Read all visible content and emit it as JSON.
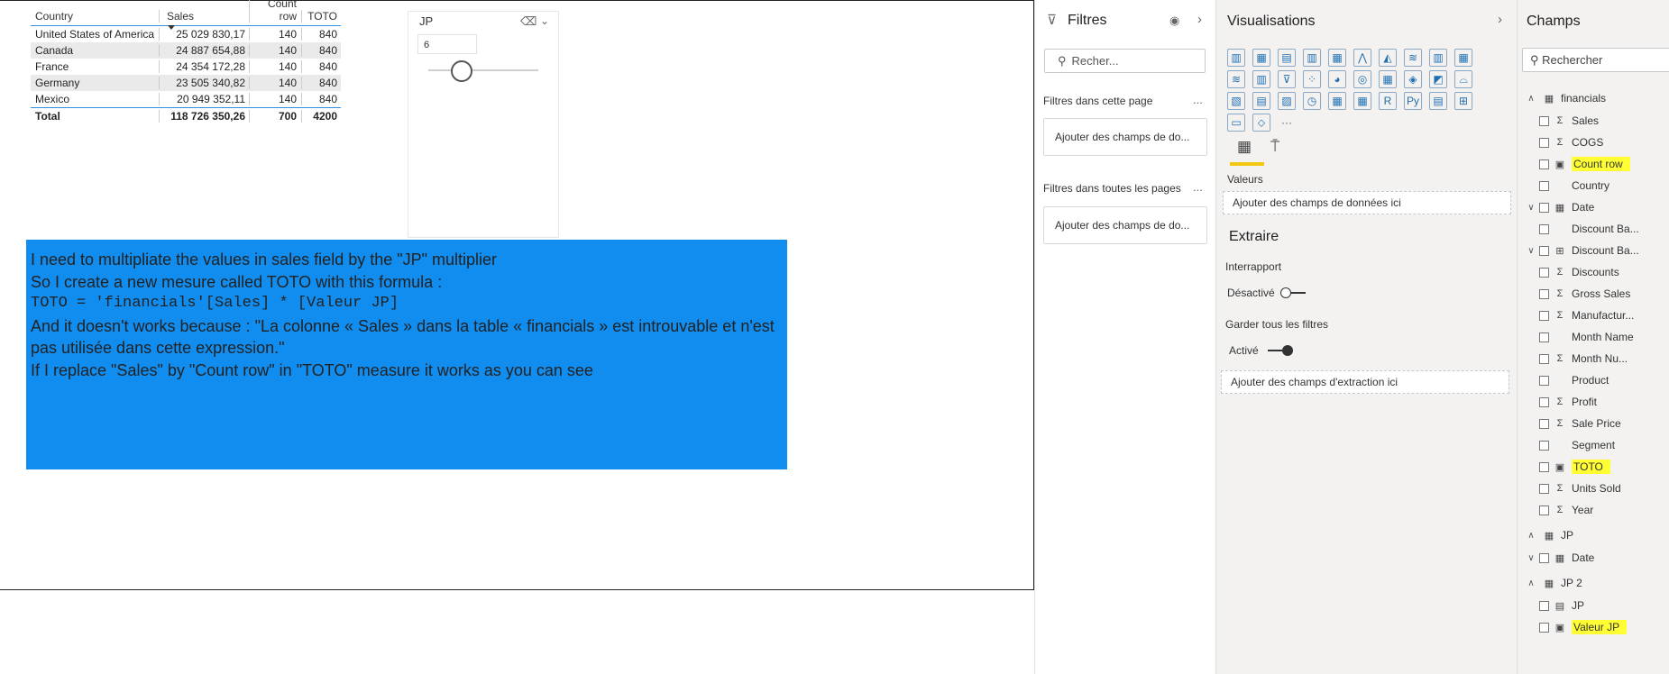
{
  "table": {
    "headers": [
      "Country",
      "Sales",
      "Count row",
      "TOTO"
    ],
    "rows": [
      [
        "United States of America",
        "25 029 830,17",
        "140",
        "840"
      ],
      [
        "Canada",
        "24 887 654,88",
        "140",
        "840"
      ],
      [
        "France",
        "24 354 172,28",
        "140",
        "840"
      ],
      [
        "Germany",
        "23 505 340,82",
        "140",
        "840"
      ],
      [
        "Mexico",
        "20 949 352,11",
        "140",
        "840"
      ]
    ],
    "total": [
      "Total",
      "118 726 350,26",
      "700",
      "4200"
    ]
  },
  "slicer": {
    "title": "JP",
    "value": "6",
    "eraser_icon": "eraser-icon",
    "chevron_icon": "chevron-down-icon",
    "level": 0.3
  },
  "note": {
    "lines": [
      "I need to multipliate the values in sales field by the \"JP\" multiplier",
      "So I create a new mesure called TOTO with this formula :",
      "TOTO = 'financials'[Sales] * [Valeur JP]",
      "And it doesn't works because : \"La colonne « Sales » dans la table « financials » est introuvable et n'est pas utilisée dans cette expression.\"",
      "If I replace \"Sales\" by \"Count row\" in \"TOTO\" measure it works as you can see"
    ],
    "color": "#118df0"
  },
  "filters": {
    "title": "Filtres",
    "search_placeholder": "Recher...",
    "page_section": "Filtres dans cette page",
    "page_well": "Ajouter des champs de do...",
    "all_section": "Filtres dans toutes les pages",
    "all_well": "Ajouter des champs de do...",
    "more": "..."
  },
  "visualizations": {
    "title": "Visualisations",
    "icons": [
      "▥",
      "▦",
      "▤",
      "▥",
      "▦",
      "⋀",
      "◭",
      "≋",
      "▥",
      "▦",
      "≋",
      "▥",
      "⊽",
      "⁘",
      "◕",
      "◎",
      "▦",
      "◈",
      "◩",
      "⌓",
      "▧",
      "▤",
      "▨",
      "◷",
      "▦",
      "▦",
      "R",
      "Py",
      "▤",
      "⊞",
      "▭",
      "⬦",
      "···"
    ],
    "values_label": "Valeurs",
    "values_well": "Ajouter des champs de données ici",
    "extract_title": "Extraire",
    "interreport_label": "Interrapport",
    "interreport_state": "Désactivé",
    "keepfilters_label": "Garder tous les filtres",
    "keepfilters_state": "Activé",
    "extract_well": "Ajouter des champs d'extraction ici"
  },
  "fields": {
    "title": "Champs",
    "search_placeholder": "Rechercher",
    "tables": [
      {
        "name": "financials",
        "items": [
          {
            "label": "Sales",
            "type": "Σ"
          },
          {
            "label": "COGS",
            "type": "Σ"
          },
          {
            "label": "Count row",
            "type": "calc",
            "highlight": true
          },
          {
            "label": "Country",
            "type": ""
          },
          {
            "label": "Date",
            "type": "cal",
            "expand": true
          },
          {
            "label": "Discount Ba...",
            "type": ""
          },
          {
            "label": "Discount Ba...",
            "type": "hier",
            "expand": true
          },
          {
            "label": "Discounts",
            "type": "Σ"
          },
          {
            "label": "Gross Sales",
            "type": "Σ"
          },
          {
            "label": "Manufactur...",
            "type": "Σ"
          },
          {
            "label": "Month Name",
            "type": ""
          },
          {
            "label": "Month Nu...",
            "type": "Σ"
          },
          {
            "label": "Product",
            "type": ""
          },
          {
            "label": "Profit",
            "type": "Σ"
          },
          {
            "label": "Sale Price",
            "type": "Σ"
          },
          {
            "label": "Segment",
            "type": ""
          },
          {
            "label": "TOTO",
            "type": "calc",
            "highlight": true
          },
          {
            "label": "Units Sold",
            "type": "Σ"
          },
          {
            "label": "Year",
            "type": "Σ"
          }
        ]
      },
      {
        "name": "JP",
        "items": [
          {
            "label": "Date",
            "type": "cal",
            "expand": true
          }
        ]
      },
      {
        "name": "JP 2",
        "items": [
          {
            "label": "JP",
            "type": "param"
          },
          {
            "label": "Valeur JP",
            "type": "calc",
            "highlight": true
          }
        ]
      }
    ]
  }
}
